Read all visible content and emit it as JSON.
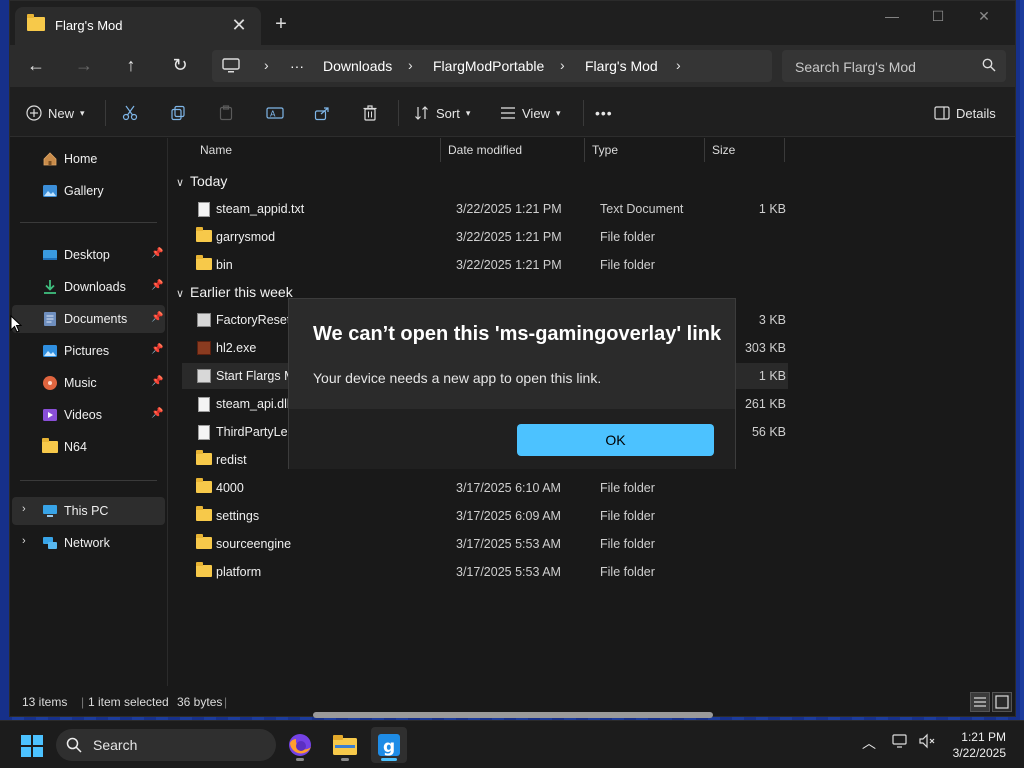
{
  "window": {
    "tab_title": "Flarg's Mod",
    "minimize": "—",
    "maximize": "☐",
    "close": "✕"
  },
  "nav": {
    "back": "←",
    "forward": "→",
    "up": "↑",
    "refresh": "↻",
    "breadcrumbs": [
      "Downloads",
      "FlargModPortable",
      "Flarg's Mod"
    ],
    "more_crumbs": "···",
    "search_placeholder": "Search Flarg's Mod"
  },
  "toolbar": {
    "new_label": "New",
    "sort_label": "Sort",
    "view_label": "View",
    "more_label": "•••",
    "details_label": "Details"
  },
  "sidebar": {
    "items": [
      {
        "label": "Home",
        "icon": "home-icon"
      },
      {
        "label": "Gallery",
        "icon": "gallery-icon"
      },
      {
        "label": "Desktop",
        "icon": "desktop-icon",
        "pinned": true
      },
      {
        "label": "Downloads",
        "icon": "download-icon",
        "pinned": true
      },
      {
        "label": "Documents",
        "icon": "documents-icon",
        "pinned": true,
        "selected": true
      },
      {
        "label": "Pictures",
        "icon": "pictures-icon",
        "pinned": true
      },
      {
        "label": "Music",
        "icon": "music-icon",
        "pinned": true
      },
      {
        "label": "Videos",
        "icon": "videos-icon",
        "pinned": true
      },
      {
        "label": "N64",
        "icon": "folder-icon"
      },
      {
        "label": "This PC",
        "icon": "pc-icon"
      },
      {
        "label": "Network",
        "icon": "network-icon"
      }
    ]
  },
  "columns": {
    "name": "Name",
    "date": "Date modified",
    "type": "Type",
    "size": "Size"
  },
  "groups": {
    "today": "Today",
    "earlier": "Earlier this week"
  },
  "files": [
    {
      "name": "steam_appid.txt",
      "date": "3/22/2025 1:21 PM",
      "type": "Text Document",
      "size": "1 KB",
      "kind": "doc"
    },
    {
      "name": "garrysmod",
      "date": "3/22/2025 1:21 PM",
      "type": "File folder",
      "size": "",
      "kind": "folder"
    },
    {
      "name": "bin",
      "date": "3/22/2025 1:21 PM",
      "type": "File folder",
      "size": "",
      "kind": "folder"
    },
    {
      "name": "FactoryReset-FM",
      "date": "",
      "type": "",
      "size": "3 KB",
      "kind": "exe"
    },
    {
      "name": "hl2.exe",
      "date": "",
      "type": "",
      "size": "303 KB",
      "kind": "hl"
    },
    {
      "name": "Start Flargs Mod",
      "date": "",
      "type": "",
      "size": "1 KB",
      "kind": "exe",
      "selected": true
    },
    {
      "name": "steam_api.dll",
      "date": "",
      "type": "",
      "size": "261 KB",
      "kind": "doc"
    },
    {
      "name": "ThirdPartyLegal",
      "date": "",
      "type": "",
      "size": "56 KB",
      "kind": "doc"
    },
    {
      "name": "redist",
      "date": "",
      "type": "",
      "size": "",
      "kind": "folder"
    },
    {
      "name": "4000",
      "date": "3/17/2025 6:10 AM",
      "type": "File folder",
      "size": "",
      "kind": "folder"
    },
    {
      "name": "settings",
      "date": "3/17/2025 6:09 AM",
      "type": "File folder",
      "size": "",
      "kind": "folder"
    },
    {
      "name": "sourceengine",
      "date": "3/17/2025 5:53 AM",
      "type": "File folder",
      "size": "",
      "kind": "folder"
    },
    {
      "name": "platform",
      "date": "3/17/2025 5:53 AM",
      "type": "File folder",
      "size": "",
      "kind": "folder"
    }
  ],
  "status": {
    "items": "13 items",
    "selected": "1 item selected",
    "bytes": "36 bytes"
  },
  "dialog": {
    "title": "We can’t open this 'ms-gamingoverlay' link",
    "message": "Your device needs a new app to open this link.",
    "ok": "OK"
  },
  "taskbar": {
    "search_label": "Search",
    "time": "1:21 PM",
    "date": "3/22/2025",
    "tray_chevron": "︿"
  },
  "colors": {
    "accent": "#4cc2ff",
    "folder": "#f7c94a",
    "window_bg": "#191919"
  }
}
